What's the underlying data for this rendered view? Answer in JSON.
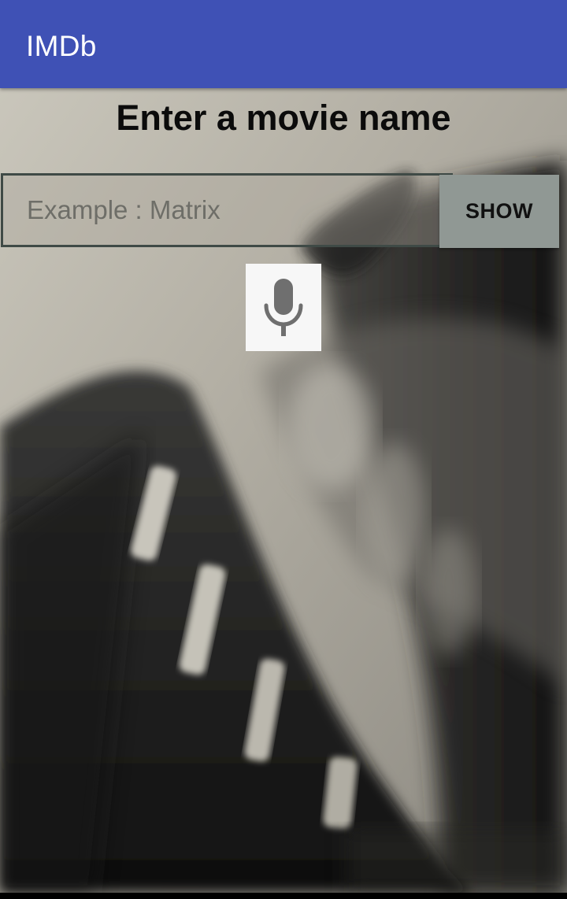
{
  "app_bar": {
    "title": "IMDb",
    "color": "#3f51b5"
  },
  "main": {
    "heading": "Enter a movie name",
    "search": {
      "placeholder": "Example : Matrix",
      "value": ""
    },
    "show_button_label": "SHOW",
    "mic_icon": "microphone-icon",
    "background": "film-strip-photo"
  },
  "colors": {
    "show_button_bg": "#909894",
    "input_border": "#3f4a46"
  }
}
